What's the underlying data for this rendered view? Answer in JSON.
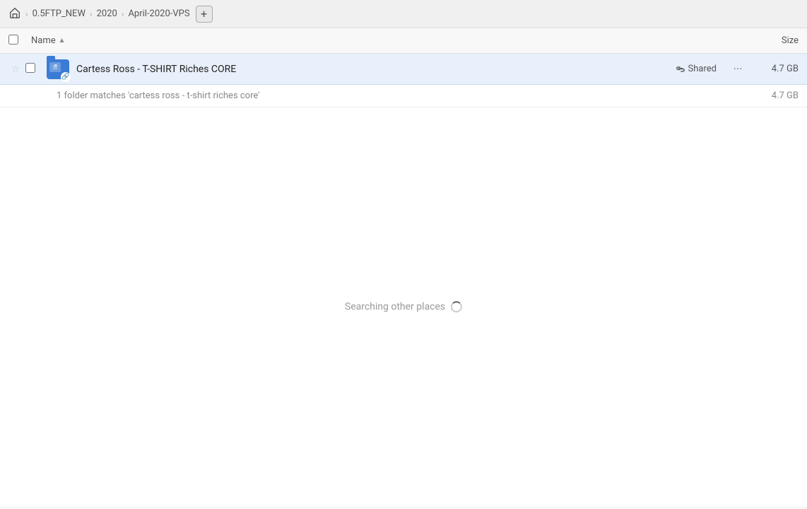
{
  "breadcrumb": {
    "home_icon": "🏠",
    "items": [
      {
        "label": "0.5FTP_NEW",
        "id": "breadcrumb-sftp"
      },
      {
        "label": "2020",
        "id": "breadcrumb-2020"
      },
      {
        "label": "April-2020-VPS",
        "id": "breadcrumb-april"
      }
    ],
    "add_button_label": "+"
  },
  "columns": {
    "name_label": "Name",
    "sort_indicator": "▲",
    "size_label": "Size"
  },
  "file_row": {
    "name": "Cartess Ross - T-SHIRT Riches CORE",
    "shared_label": "Shared",
    "size": "4.7 GB",
    "more_icon": "···"
  },
  "match_row": {
    "text": "1 folder matches 'cartess ross - t-shirt riches core'",
    "size": "4.7 GB"
  },
  "searching": {
    "label": "Searching other places"
  }
}
